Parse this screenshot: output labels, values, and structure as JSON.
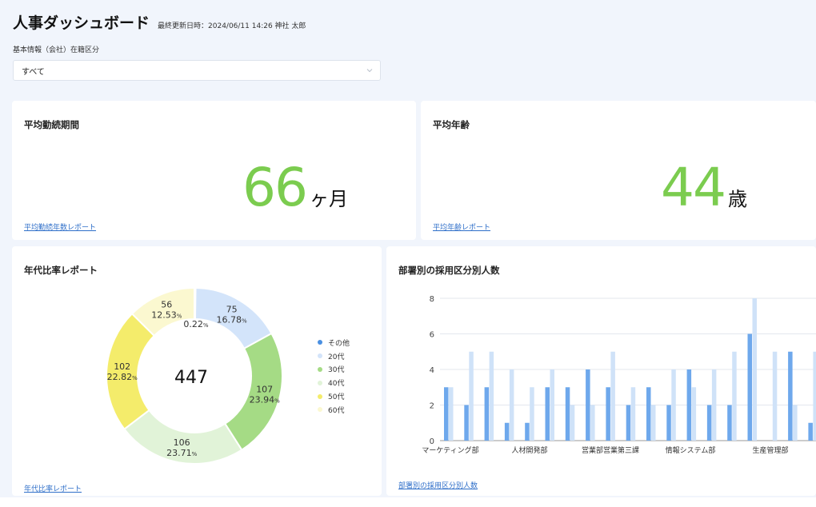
{
  "header": {
    "title": "人事ダッシュボード",
    "updated": "最終更新日時：2024/06/11 14:26 神社 太郎"
  },
  "filter": {
    "label": "基本情報（会社）在籍区分",
    "value": "すべて"
  },
  "tenure_card": {
    "title": "平均勤続期間",
    "value": "66",
    "unit": "ヶ月",
    "link": "平均勤続年数レポート"
  },
  "age_card": {
    "title": "平均年齢",
    "value": "44",
    "unit": "歳",
    "link": "平均年齢レポート"
  },
  "age_ratio_card": {
    "title": "年代比率レポート",
    "total": "447",
    "link": "年代比率レポート"
  },
  "dept_card": {
    "title": "部署別の採用区分別人数",
    "link": "部署別の採用区分別人数"
  },
  "chart_data": [
    {
      "type": "pie",
      "donut": true,
      "center_label": "447",
      "slices": [
        {
          "name": "その他",
          "value": 1,
          "percent": "0.22",
          "color": "#4a90e2"
        },
        {
          "name": "20代",
          "value": 75,
          "percent": "16.78",
          "color": "#d3e4fa"
        },
        {
          "name": "30代",
          "value": 107,
          "percent": "23.94",
          "color": "#a5db85"
        },
        {
          "name": "40代",
          "value": 106,
          "percent": "23.71",
          "color": "#e1f3d8"
        },
        {
          "name": "50代",
          "value": 102,
          "percent": "22.82",
          "color": "#f4ec6b"
        },
        {
          "name": "60代",
          "value": 56,
          "percent": "12.53",
          "color": "#fbf8d0"
        }
      ],
      "percent_suffix": "%",
      "legend_position": "right"
    },
    {
      "type": "bar",
      "ylim": [
        0,
        8
      ],
      "yticks": [
        "0",
        "2",
        "4",
        "6",
        "8"
      ],
      "grid": true,
      "category_labels": [
        "マーケティング部",
        "人材開発部",
        "営業部営業第三課",
        "情報システム部",
        "生産管理部"
      ],
      "groups": [
        [
          3,
          3
        ],
        [
          2,
          5
        ],
        [
          3,
          5
        ],
        [
          1,
          4
        ],
        [
          1,
          3
        ],
        [
          3,
          4
        ],
        [
          3,
          2
        ],
        [
          4,
          2
        ],
        [
          3,
          5
        ],
        [
          2,
          3
        ],
        [
          3,
          2
        ],
        [
          2,
          4
        ],
        [
          4,
          3
        ],
        [
          2,
          4
        ],
        [
          2,
          5
        ],
        [
          6,
          8
        ],
        [
          0,
          5
        ],
        [
          5,
          2
        ],
        [
          1,
          5
        ]
      ],
      "series_colors": [
        "#6ea8ec",
        "#cfe2f8"
      ]
    }
  ]
}
